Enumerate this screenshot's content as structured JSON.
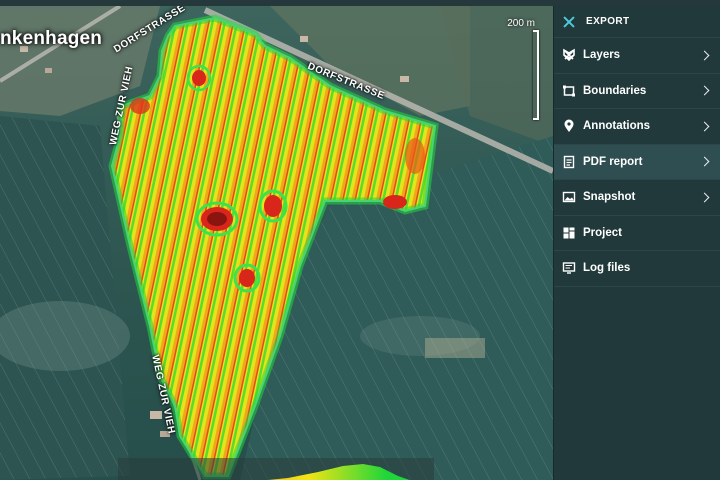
{
  "map": {
    "place_label": "nkenhagen",
    "road_labels": [
      "DORFSTRASSE",
      "DORFSTRASSE",
      "WEG ZUR VIEH",
      "WEG ZUR VIEH"
    ],
    "scale_label": "200 m"
  },
  "sidebar": {
    "title": "EXPORT",
    "items": [
      {
        "label": "Layers",
        "icon": "layers-icon",
        "has_submenu": true,
        "active": false
      },
      {
        "label": "Boundaries",
        "icon": "boundaries-icon",
        "has_submenu": true,
        "active": false
      },
      {
        "label": "Annotations",
        "icon": "location-pin-icon",
        "has_submenu": true,
        "active": false
      },
      {
        "label": "PDF report",
        "icon": "document-icon",
        "has_submenu": true,
        "active": true
      },
      {
        "label": "Snapshot",
        "icon": "image-icon",
        "has_submenu": true,
        "active": false
      },
      {
        "label": "Project",
        "icon": "grid-icon",
        "has_submenu": false,
        "active": false
      },
      {
        "label": "Log files",
        "icon": "monitor-icon",
        "has_submenu": false,
        "active": false
      }
    ]
  },
  "colors": {
    "accent": "#4fc9d9",
    "sidebar_bg": "#21393b",
    "active_item_bg": "#2f4e52",
    "ndvi_high": "#1fd63a",
    "ndvi_mid": "#f2e514",
    "ndvi_low": "#e0321b"
  }
}
